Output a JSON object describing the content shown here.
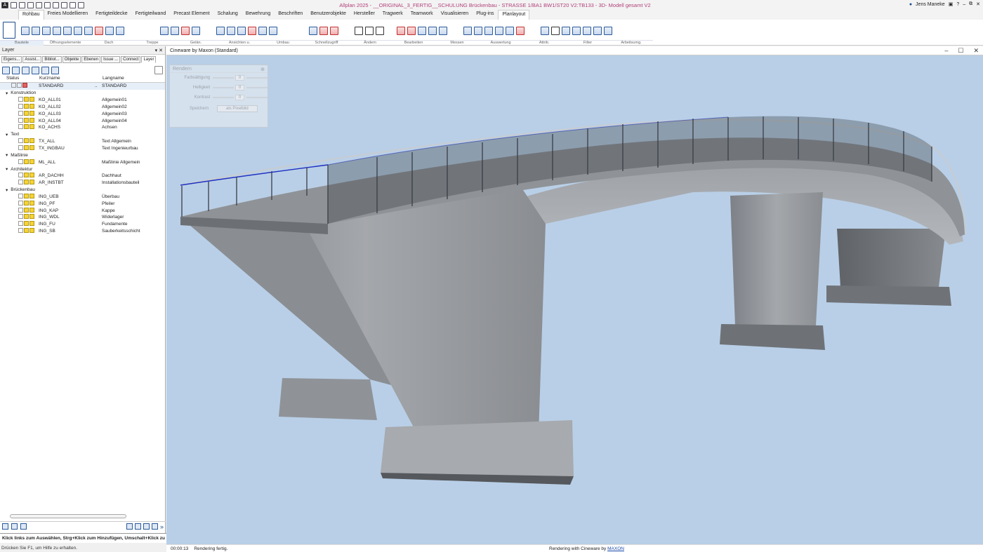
{
  "app": {
    "title": "Allplan 2025 - __ORIGINAL_3_FERTIG__SCHULUNG Brückenbau - STRASSE 1/BA1 BW1/ST20 V2:TB133 - 3D- Modell gesamt V2",
    "user": "Jens Maneke",
    "help": "?"
  },
  "menu_tabs": [
    "Rohbau",
    "Freies Modellieren",
    "Fertigteildecke",
    "Fertigteilwand",
    "Precast Element",
    "Schalung",
    "Bewehrung",
    "Beschriften",
    "Benutzerobjekte",
    "Hersteller",
    "Tragwerk",
    "Teamwork",
    "Visualisieren",
    "Plug-ins",
    "Planlayout"
  ],
  "active_tab": "Planlayout",
  "ribbon_groups": [
    "Bauteile",
    "Öffnungselemente",
    "Dach",
    "Treppe",
    "Gelän.",
    "Ansichten u.",
    "Umbau",
    "Schnellzugriff",
    "Ändern",
    "Bearbeiten",
    "Messen",
    "Auswertung",
    "Attrib.",
    "Filter",
    "Arbeitsumg."
  ],
  "layer_panel": {
    "title": "Layer",
    "tabs": [
      "Eigens...",
      "Assist...",
      "Bibliot...",
      "Objekte",
      "Ebenen",
      "Issue ...",
      "Connect",
      "Layer"
    ],
    "col_status": "Status",
    "col_kurzname": "Kurzname",
    "col_langname": "Langname",
    "rows": [
      {
        "type": "layer",
        "depth": 1,
        "kurz": "STANDARD",
        "lang": "STANDARD",
        "dots": "..",
        "selected": true,
        "current": true
      },
      {
        "type": "group",
        "label": "Konstruktion"
      },
      {
        "type": "layer",
        "depth": 2,
        "kurz": "KO_ALL01",
        "lang": "Allgemein01"
      },
      {
        "type": "layer",
        "depth": 2,
        "kurz": "KO_ALL02",
        "lang": "Allgemein02"
      },
      {
        "type": "layer",
        "depth": 2,
        "kurz": "KO_ALL03",
        "lang": "Allgemein03"
      },
      {
        "type": "layer",
        "depth": 2,
        "kurz": "KO_ALL04",
        "lang": "Allgemein04"
      },
      {
        "type": "layer",
        "depth": 2,
        "kurz": "KO_ACHS",
        "lang": "Achsen"
      },
      {
        "type": "group",
        "label": "Text"
      },
      {
        "type": "layer",
        "depth": 2,
        "kurz": "TX_ALL",
        "lang": "Text Allgemein"
      },
      {
        "type": "layer",
        "depth": 2,
        "kurz": "TX_INGBAU",
        "lang": "Text Ingenieurbau"
      },
      {
        "type": "group",
        "label": "Maßlinie"
      },
      {
        "type": "layer",
        "depth": 2,
        "kurz": "ML_ALL",
        "lang": "Maßlinie Allgemein"
      },
      {
        "type": "group",
        "label": "Architektur"
      },
      {
        "type": "layer",
        "depth": 2,
        "kurz": "AR_DACHH",
        "lang": "Dachhaut"
      },
      {
        "type": "layer",
        "depth": 2,
        "kurz": "AR_INSTBT",
        "lang": "Installationsbauteil"
      },
      {
        "type": "group",
        "label": "Brückenbau"
      },
      {
        "type": "layer",
        "depth": 2,
        "kurz": "ING_UEB",
        "lang": "Überbau"
      },
      {
        "type": "layer",
        "depth": 2,
        "kurz": "ING_PF",
        "lang": "Pfeiler"
      },
      {
        "type": "layer",
        "depth": 2,
        "kurz": "ING_KAP",
        "lang": "Kappe"
      },
      {
        "type": "layer",
        "depth": 2,
        "kurz": "ING_WDL",
        "lang": "Widerlager"
      },
      {
        "type": "layer",
        "depth": 2,
        "kurz": "ING_FU",
        "lang": "Fundamente"
      },
      {
        "type": "layer",
        "depth": 2,
        "kurz": "ING_SB",
        "lang": "Sauberkeitsschicht"
      }
    ]
  },
  "prompt": "Klick links zum Auswählen, Strg+Klick zum Hinzufügen, Umschalt+Klick zu",
  "status_help": "Drücken Sie F1, um Hilfe zu erhalten.",
  "viewer": {
    "title": "Cineware by Maxon (Standard)",
    "render_panel": {
      "title": "Rendern",
      "sliders": [
        {
          "label": "Farbsättigung",
          "value": "0"
        },
        {
          "label": "Helligkeit",
          "value": "0"
        },
        {
          "label": "Kontrast",
          "value": "0"
        }
      ],
      "save_label": "Speichern",
      "save_button": "als Pixelbild"
    },
    "status_time": "00:00:13",
    "status_text": "Rendering fertig.",
    "center_text": "Rendering with Cineware by ",
    "center_link": "MAXON"
  },
  "colors": {
    "title_text": "#b0407a",
    "canvas_bg": "#b9cfe7",
    "link": "#1a4aaa"
  }
}
